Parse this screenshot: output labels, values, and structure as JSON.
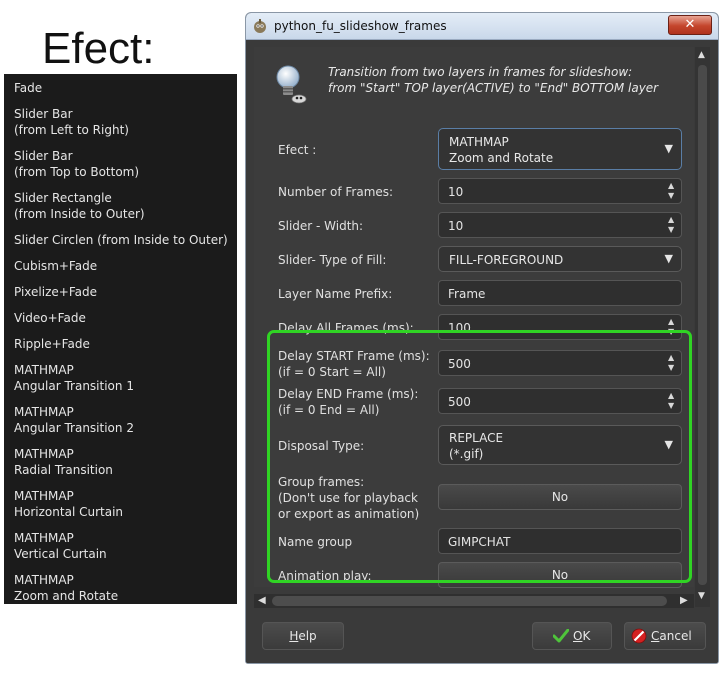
{
  "annotation": {
    "title": "Efect:",
    "items": [
      {
        "line1": "Fade",
        "line2": ""
      },
      {
        "line1": "Slider Bar",
        "line2": "(from Left to Right)"
      },
      {
        "line1": "Slider Bar",
        "line2": "(from Top to Bottom)"
      },
      {
        "line1": "Slider Rectangle",
        "line2": "(from Inside to Outer)"
      },
      {
        "line1": "Slider Circlen (from Inside to Outer)",
        "line2": ""
      },
      {
        "line1": "Cubism+Fade",
        "line2": ""
      },
      {
        "line1": "Pixelize+Fade",
        "line2": ""
      },
      {
        "line1": "Video+Fade",
        "line2": ""
      },
      {
        "line1": "Ripple+Fade",
        "line2": ""
      },
      {
        "line1": "MATHMAP",
        "line2": "Angular Transition 1"
      },
      {
        "line1": "MATHMAP",
        "line2": "Angular Transition 2"
      },
      {
        "line1": "MATHMAP",
        "line2": "Radial Transition"
      },
      {
        "line1": "MATHMAP",
        "line2": "Horizontal Curtain"
      },
      {
        "line1": "MATHMAP",
        "line2": "Vertical Curtain"
      },
      {
        "line1": "MATHMAP",
        "line2": "Zoom and Rotate"
      }
    ]
  },
  "window": {
    "title": "python_fu_slideshow_frames",
    "close_label": "✕",
    "description_line1": "Transition from two layers in frames for slideshow:",
    "description_line2": "from \"Start\" TOP layer(ACTIVE) to \"End\" BOTTOM layer"
  },
  "form": {
    "efect": {
      "label": "Efect :",
      "value_line1": "MATHMAP",
      "value_line2": "Zoom and Rotate"
    },
    "num_frames": {
      "label": "Number of Frames:",
      "value": "10"
    },
    "slider_width": {
      "label": "Slider - Width:",
      "value": "10"
    },
    "slider_fill": {
      "label": "Slider- Type of Fill:",
      "value": "FILL-FOREGROUND"
    },
    "layer_prefix": {
      "label": "Layer Name Prefix:",
      "value": "Frame"
    },
    "delay_all": {
      "label": "Delay All Frames (ms):",
      "value": "100"
    },
    "delay_start": {
      "label_line1": "Delay START Frame (ms):",
      "label_line2": "(if = 0 Start = All)",
      "value": "500"
    },
    "delay_end": {
      "label_line1": "Delay END Frame (ms):",
      "label_line2": "(if = 0 End = All)",
      "value": "500"
    },
    "disposal": {
      "label": "Disposal Type:",
      "value_line1": "REPLACE",
      "value_line2": "(*.gif)"
    },
    "group_frames": {
      "label_line1": "Group frames:",
      "label_line2": "(Don't use  for playback",
      "label_line3": "or export as animation)",
      "value": "No"
    },
    "name_group": {
      "label": "Name group",
      "value": "GIMPCHAT"
    },
    "animation_play": {
      "label": "Animation play:",
      "value": "No"
    }
  },
  "buttons": {
    "help_letter": "H",
    "help_rest": "elp",
    "ok_letter": "O",
    "ok_rest": "K",
    "cancel_letter": "C",
    "cancel_rest": "ancel"
  },
  "colors": {
    "highlight": "#30d424",
    "ok_check": "#4fc43b",
    "cancel_icon": "#d42020"
  }
}
